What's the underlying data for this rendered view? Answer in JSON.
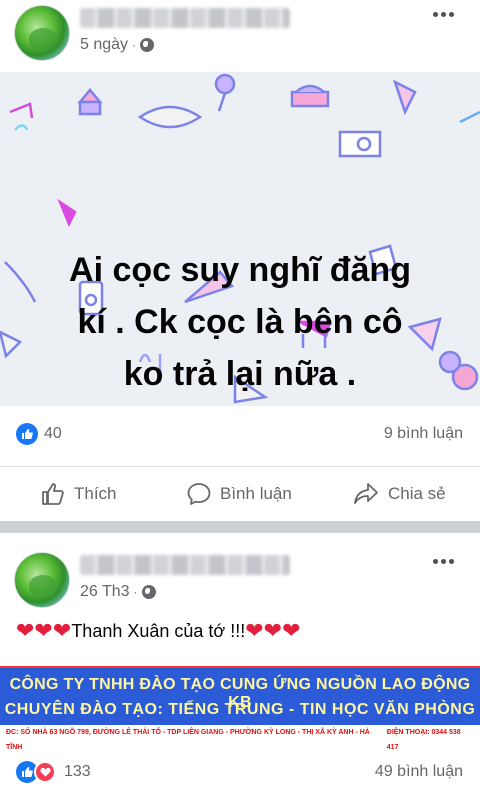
{
  "posts": [
    {
      "timestamp": "5 ngày",
      "banner_text_lines": [
        "Ai cọc suy nghĩ đăng",
        "kí . Ck cọc là bên cô",
        "ko trả lại nữa ."
      ],
      "reaction_count": "40",
      "comment_count": "9 bình luận",
      "actions": {
        "like": "Thích",
        "comment": "Bình luận",
        "share": "Chia sẻ"
      }
    },
    {
      "timestamp": "26 Th3",
      "caption_text": "Thanh Xuân của tớ !!!",
      "hearts_before": "❤❤❤",
      "hearts_after": "❤❤❤",
      "ad": {
        "line1": "CÔNG TY TNHH ĐÀO TẠO CUNG ỨNG NGUỒN LAO ĐỘNG KB",
        "line2": "CHUYÊN ĐÀO TẠO: TIẾNG TRUNG - TIN HỌC VĂN PHÒNG",
        "address": "ĐC: SỐ NHÀ 63 NGÕ 799, ĐƯỜNG LÊ THÁI TỔ - TDP LIÊN GIANG - PHƯỜNG KỲ LONG - THỊ XÃ KỲ ANH - HÀ TĨNH",
        "phone": "ĐIỆN THOẠI: 0344 538 417"
      },
      "reaction_count": "133",
      "comment_count": "49 bình luận"
    }
  ],
  "colors": {
    "like_blue": "#1877f2",
    "love_red": "#f33e58",
    "heart_red": "#e41e3f",
    "ad_blue": "#2c5bd7",
    "ad_text": "#fff6a0"
  },
  "icons": [
    "globe-icon",
    "more-icon",
    "like-badge-icon",
    "love-badge-icon",
    "thumb-up-icon",
    "comment-icon",
    "share-icon"
  ]
}
